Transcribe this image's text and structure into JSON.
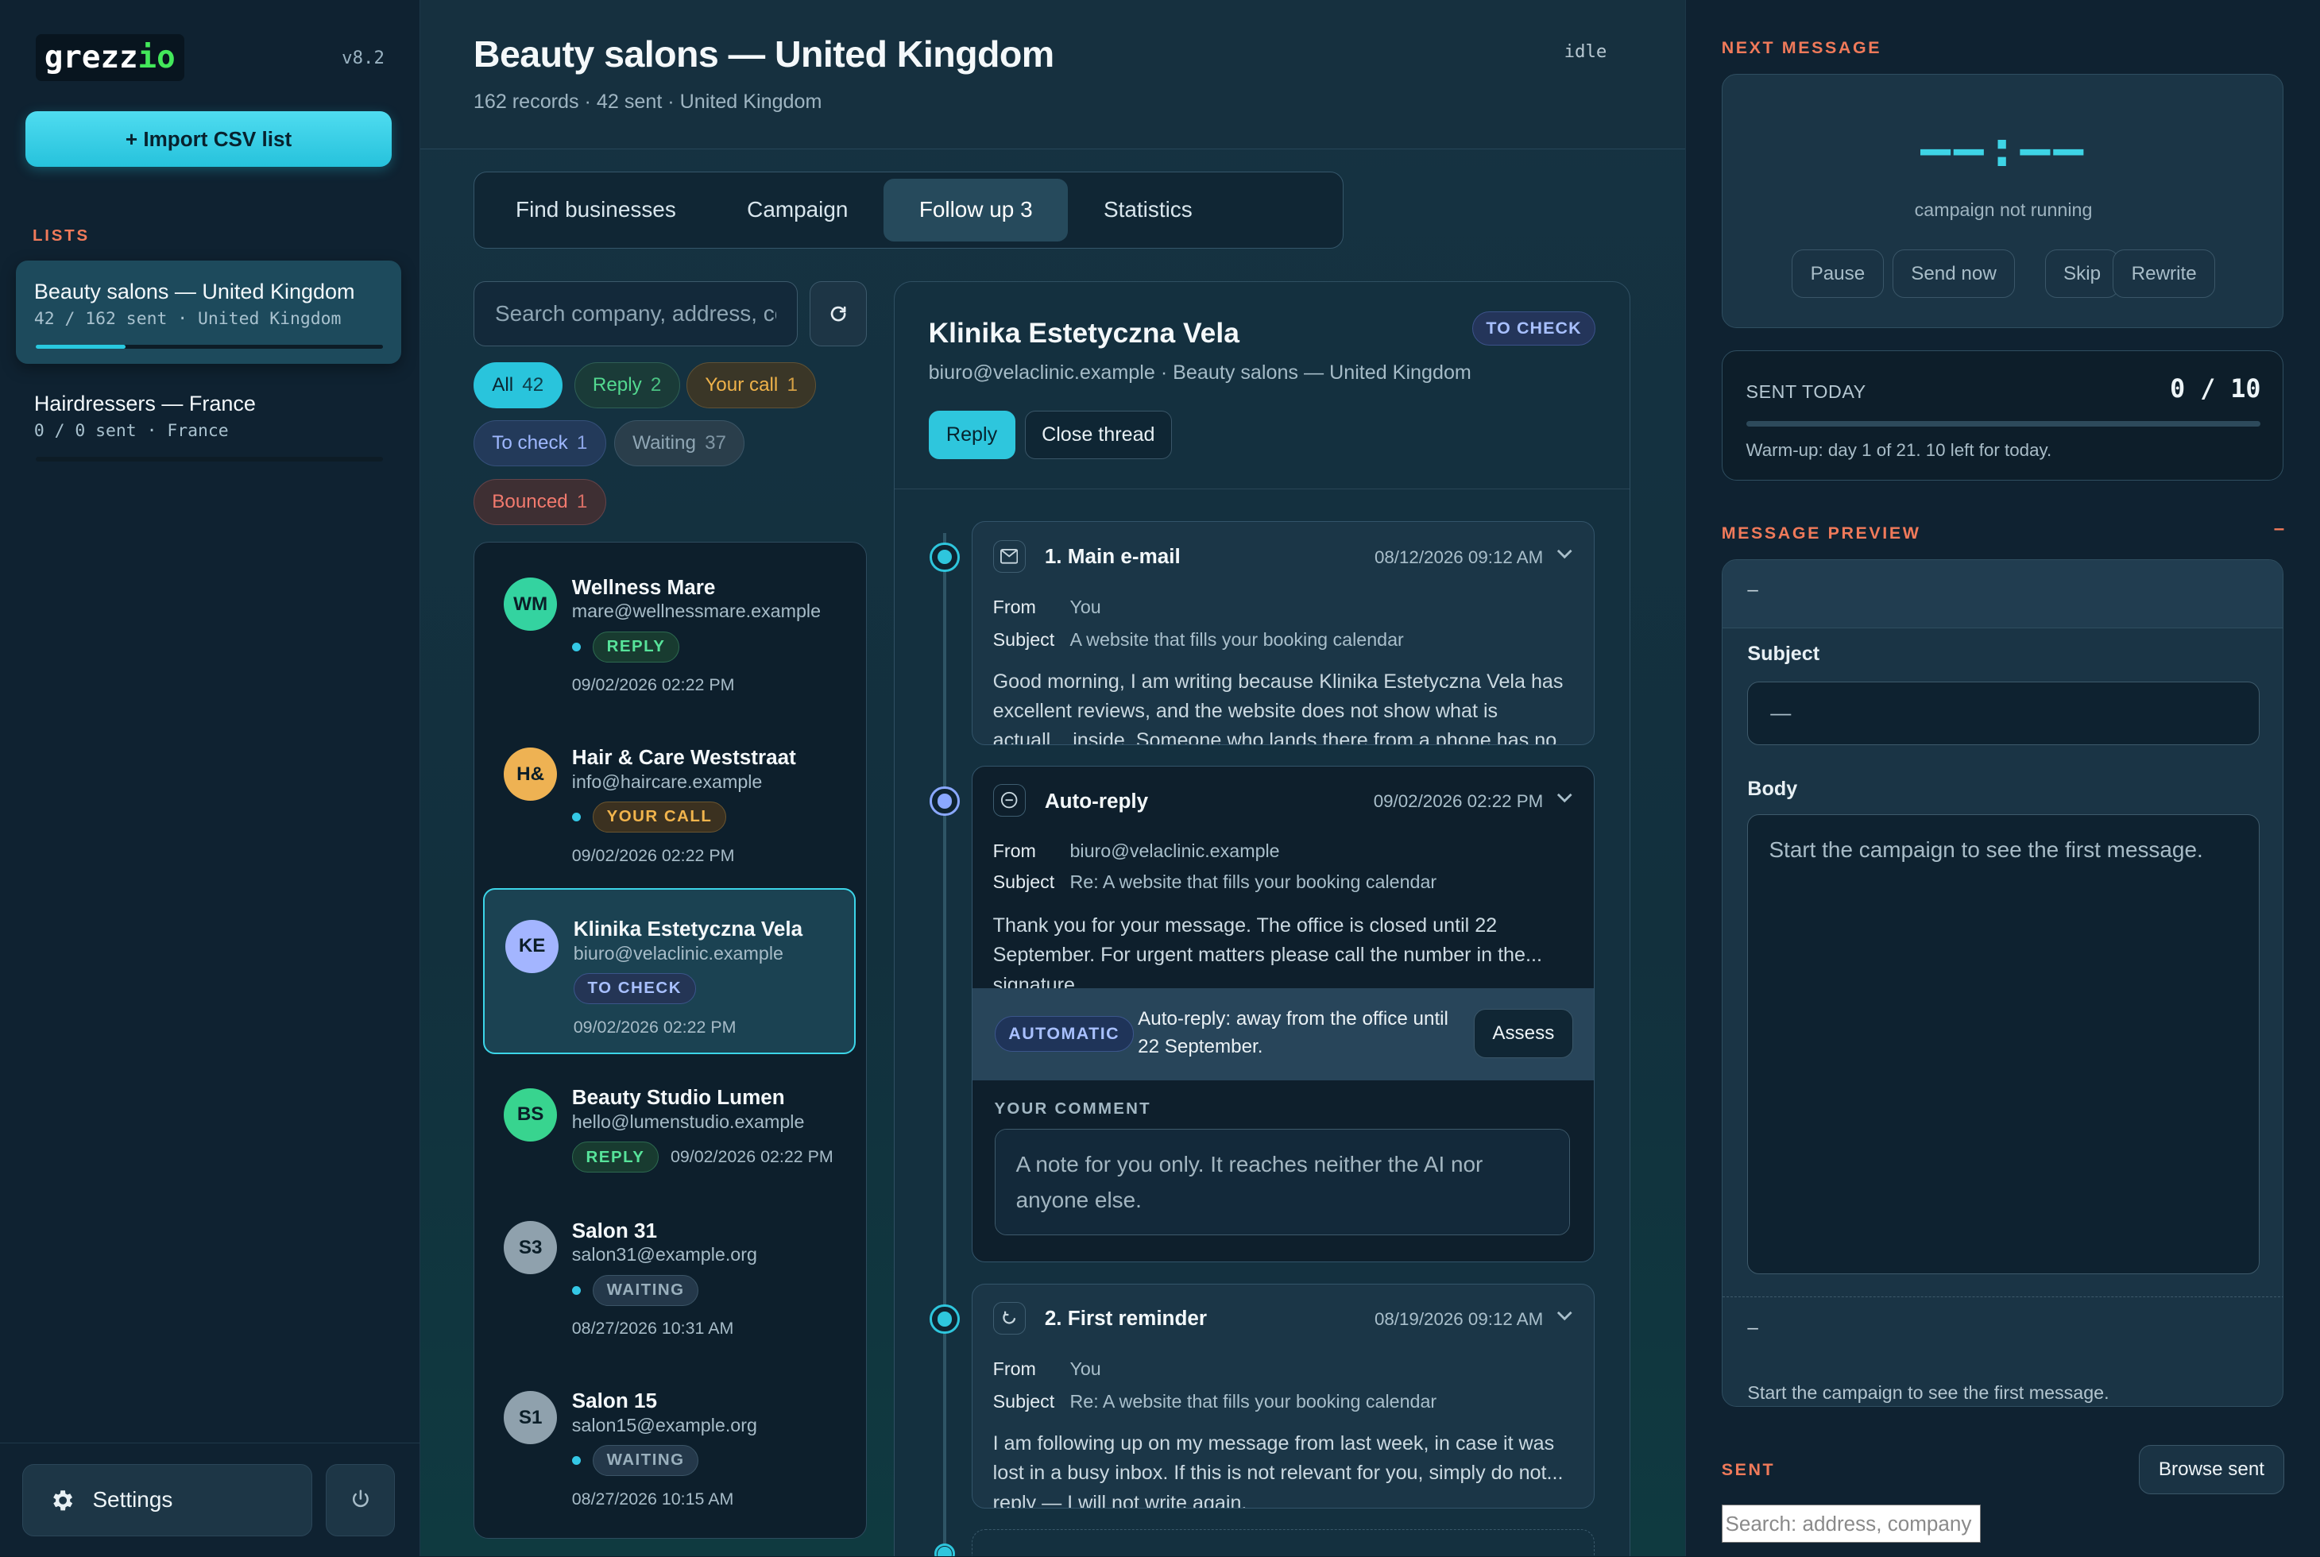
{
  "app": {
    "logo_main": "grezz",
    "logo_accent": "io",
    "version": "v8.2"
  },
  "sidebar": {
    "import_button": "+ Import CSV list",
    "lists_label": "LISTS",
    "lists": [
      {
        "name": "Beauty salons — United Kingdom",
        "meta": "42 / 162 sent · United Kingdom",
        "progress": 0.26
      },
      {
        "name": "Hairdressers — France",
        "meta": "0 / 0 sent · France",
        "progress": 0
      }
    ],
    "settings_label": "Settings"
  },
  "header": {
    "title": "Beauty salons — United Kingdom",
    "subtitle": "162 records · 42 sent · United Kingdom",
    "status": "idle"
  },
  "tabs": [
    {
      "label": "Find businesses"
    },
    {
      "label": "Campaign"
    },
    {
      "label": "Follow up 3",
      "active": true
    },
    {
      "label": "Statistics"
    }
  ],
  "search": {
    "placeholder": "Search company, address, co"
  },
  "filters": {
    "all": {
      "label": "All",
      "count": "42"
    },
    "reply": {
      "label": "Reply",
      "count": "2"
    },
    "call": {
      "label": "Your call",
      "count": "1"
    },
    "check": {
      "label": "To check",
      "count": "1"
    },
    "waiting": {
      "label": "Waiting",
      "count": "37"
    },
    "bounced": {
      "label": "Bounced",
      "count": "1"
    }
  },
  "contacts": [
    {
      "initials": "WM",
      "name": "Wellness Mare",
      "email": "mare@wellnessmare.example",
      "badge": "REPLY",
      "date": "09/02/2026 02:22 PM"
    },
    {
      "initials": "H&",
      "name": "Hair & Care Weststraat",
      "email": "info@haircare.example",
      "badge": "YOUR CALL",
      "date": "09/02/2026 02:22 PM"
    },
    {
      "initials": "KE",
      "name": "Klinika Estetyczna Vela",
      "email": "biuro@velaclinic.example",
      "badge": "TO CHECK",
      "date": "09/02/2026 02:22 PM"
    },
    {
      "initials": "BS",
      "name": "Beauty Studio Lumen",
      "email": "hello@lumenstudio.example",
      "badge": "REPLY",
      "date": "09/02/2026 02:22 PM"
    },
    {
      "initials": "S3",
      "name": "Salon 31",
      "email": "salon31@example.org",
      "badge": "WAITING",
      "date": "08/27/2026 10:31 AM"
    },
    {
      "initials": "S1",
      "name": "Salon 15",
      "email": "salon15@example.org",
      "badge": "WAITING",
      "date": "08/27/2026 10:15 AM"
    }
  ],
  "thread": {
    "title": "Klinika Estetyczna Vela",
    "badge": "TO CHECK",
    "subtitle": "biuro@velaclinic.example · Beauty salons — United Kingdom",
    "reply_button": "Reply",
    "close_button": "Close thread",
    "from_label": "From",
    "subject_label": "Subject",
    "messages": [
      {
        "title": "1. Main e-mail",
        "date": "08/12/2026 09:12 AM",
        "from": "You",
        "subject": "A website that fills your booking calendar",
        "body": "Good morning, I am writing because Klinika Estetyczna Vela has excellent reviews, and the website does not show what is actuall... inside. Someone who lands there from a phone has no way to"
      },
      {
        "title": "Auto-reply",
        "date": "09/02/2026 02:22 PM",
        "from": "biuro@velaclinic.example",
        "subject": "Re: A website that fills your booking calendar",
        "body": "Thank you for your message. The office is closed until 22 September. For urgent matters please call the number in the... signature."
      },
      {
        "title": "2. First reminder",
        "date": "08/19/2026 09:12 AM",
        "from": "You",
        "subject": "Re: A website that fills your booking calendar",
        "body": "I am following up on my message from last week, in case it was lost in a busy inbox. If this is not relevant for you, simply do not... reply — I will not write again."
      }
    ],
    "auto_badge": "AUTOMATIC",
    "auto_text": "Auto-reply: away from the office until 22 September.",
    "assess_button": "Assess",
    "comment_label": "YOUR COMMENT",
    "comment_placeholder": "A note for you only. It reaches neither the AI nor anyone else."
  },
  "right": {
    "next_label": "NEXT MESSAGE",
    "timer": "––:––",
    "timer_status": "campaign not running",
    "buttons": {
      "pause": "Pause",
      "send_now": "Send now",
      "skip": "Skip",
      "rewrite": "Rewrite"
    },
    "sent_today_label": "SENT TODAY",
    "sent_today_value": "0 / 10",
    "sent_today_progress": 0,
    "warmup_note": "Warm-up: day 1 of 21. 10 left for today.",
    "preview_label": "MESSAGE PREVIEW",
    "collapse": "–",
    "preview_top": "–",
    "subject_label": "Subject",
    "subject_value": "—",
    "body_label": "Body",
    "body_value": "Start the campaign to see the first message.",
    "preview_dash": "–",
    "preview_foot": "Start the campaign to see the first message.",
    "sent_label": "SENT",
    "browse_button": "Browse sent",
    "sent_search_placeholder": "Search: address, company"
  }
}
